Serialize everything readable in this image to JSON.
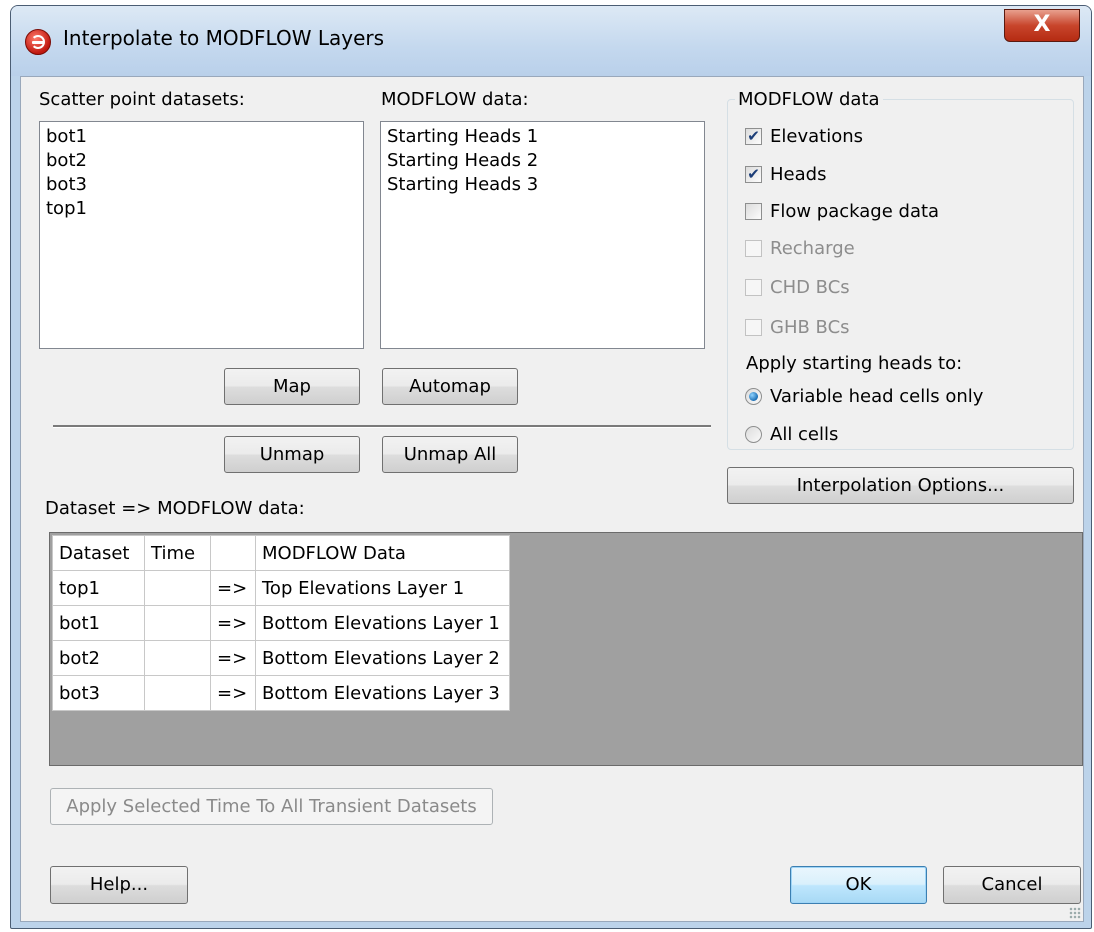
{
  "window": {
    "title": "Interpolate to MODFLOW Layers",
    "close_glyph": "X"
  },
  "scatter": {
    "label": "Scatter point datasets:",
    "items": [
      "bot1",
      "bot2",
      "bot3",
      "top1"
    ]
  },
  "modflow_list": {
    "label": "MODFLOW data:",
    "items": [
      "Starting Heads 1",
      "Starting Heads 2",
      "Starting Heads 3"
    ]
  },
  "buttons": {
    "map": "Map",
    "automap": "Automap",
    "unmap": "Unmap",
    "unmap_all": "Unmap All",
    "interpolation_options": "Interpolation Options...",
    "apply_time": "Apply Selected Time To All Transient Datasets",
    "help": "Help...",
    "ok": "OK",
    "cancel": "Cancel"
  },
  "group": {
    "title": "MODFLOW data",
    "checkboxes": [
      {
        "label": "Elevations",
        "checked": true,
        "enabled": true
      },
      {
        "label": "Heads",
        "checked": true,
        "enabled": true
      },
      {
        "label": "Flow package data",
        "checked": false,
        "enabled": true
      },
      {
        "label": "Recharge",
        "checked": false,
        "enabled": false
      },
      {
        "label": "CHD BCs",
        "checked": false,
        "enabled": false
      },
      {
        "label": "GHB BCs",
        "checked": false,
        "enabled": false
      }
    ],
    "starting_heads_label": "Apply starting heads to:",
    "radios": [
      {
        "label": "Variable head cells only",
        "selected": true
      },
      {
        "label": "All cells",
        "selected": false
      }
    ]
  },
  "mapping": {
    "label": "Dataset => MODFLOW data:",
    "columns": [
      "Dataset",
      "Time",
      "",
      "MODFLOW Data"
    ],
    "rows": [
      [
        "top1",
        "",
        "=>",
        "Top Elevations Layer 1"
      ],
      [
        "bot1",
        "",
        "=>",
        "Bottom Elevations Layer 1"
      ],
      [
        "bot2",
        "",
        "=>",
        "Bottom Elevations Layer 2"
      ],
      [
        "bot3",
        "",
        "=>",
        "Bottom Elevations Layer 3"
      ]
    ]
  },
  "icons": {
    "app": "app-logo-icon",
    "check": "check-mark-icon"
  },
  "colors": {
    "title_bar": "#bcd3ea",
    "close_button": "#c8452c",
    "dialog_bg": "#f0f0f0",
    "grid_empty_area": "#a0a0a0"
  }
}
